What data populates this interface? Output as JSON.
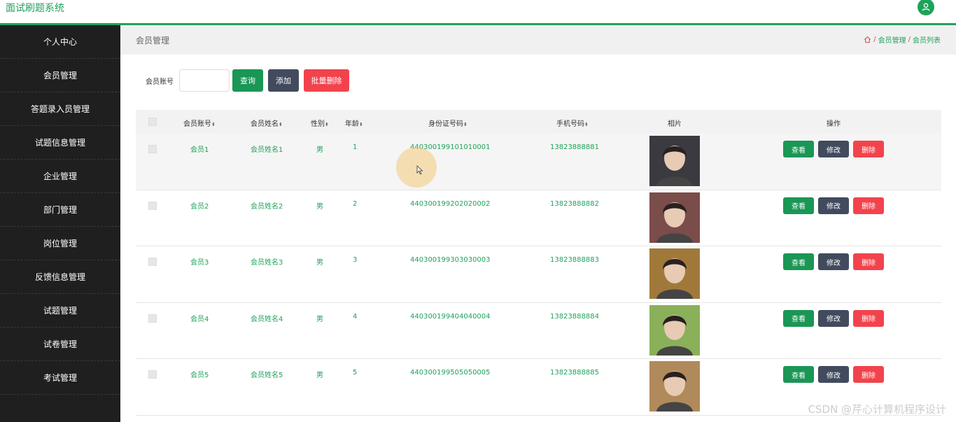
{
  "app": {
    "title": "面试刷题系统"
  },
  "sidebar": {
    "items": [
      {
        "label": "个人中心"
      },
      {
        "label": "会员管理"
      },
      {
        "label": "答题录入员管理"
      },
      {
        "label": "试题信息管理"
      },
      {
        "label": "企业管理"
      },
      {
        "label": "部门管理"
      },
      {
        "label": "岗位管理"
      },
      {
        "label": "反馈信息管理"
      },
      {
        "label": "试题管理"
      },
      {
        "label": "试卷管理"
      },
      {
        "label": "考试管理"
      }
    ]
  },
  "page": {
    "title": "会员管理",
    "breadcrumb": [
      "会员管理",
      "会员列表"
    ]
  },
  "search": {
    "label": "会员账号",
    "value": "",
    "query_button": "查询",
    "add_button": "添加",
    "batch_delete_button": "批量删除"
  },
  "table": {
    "headers": {
      "account": "会员账号",
      "name": "会员姓名",
      "gender": "性别",
      "age": "年龄",
      "idcard": "身份证号码",
      "phone": "手机号码",
      "photo": "相片",
      "actions": "操作"
    },
    "sort_glyph": "⬍",
    "actions": {
      "view": "查看",
      "edit": "修改",
      "delete": "删除"
    },
    "rows": [
      {
        "account": "会员1",
        "name": "会员姓名1",
        "gender": "男",
        "age": "1",
        "idcard": "440300199101010001",
        "phone": "13823888881",
        "photo_color": "#3a3a40"
      },
      {
        "account": "会员2",
        "name": "会员姓名2",
        "gender": "男",
        "age": "2",
        "idcard": "440300199202020002",
        "phone": "13823888882",
        "photo_color": "#7a4c4a"
      },
      {
        "account": "会员3",
        "name": "会员姓名3",
        "gender": "男",
        "age": "3",
        "idcard": "440300199303030003",
        "phone": "13823888883",
        "photo_color": "#a0793a"
      },
      {
        "account": "会员4",
        "name": "会员姓名4",
        "gender": "男",
        "age": "4",
        "idcard": "440300199404040004",
        "phone": "13823888884",
        "photo_color": "#8ab05a"
      },
      {
        "account": "会员5",
        "name": "会员姓名5",
        "gender": "男",
        "age": "5",
        "idcard": "440300199505050005",
        "phone": "13823888885",
        "photo_color": "#b08a5a"
      }
    ]
  },
  "watermark": "CSDN @芹心计算机程序设计",
  "colors": {
    "accent": "#1fa25a",
    "danger": "#f2434d",
    "dark": "#424a5e",
    "sidebar": "#1f1f1f"
  }
}
